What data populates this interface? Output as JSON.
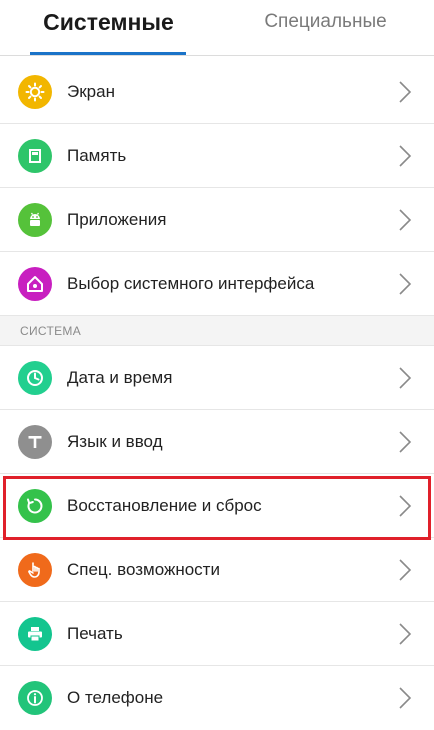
{
  "tabs": {
    "system_label": "Системные",
    "special_label": "Специальные",
    "active": "system"
  },
  "section_system_header": "СИСТЕМА",
  "items": [
    {
      "label": "Экран",
      "icon": "screen-brightness-icon",
      "color": "#f2b600"
    },
    {
      "label": "Память",
      "icon": "memory-card-icon",
      "color": "#2ec56a"
    },
    {
      "label": "Приложения",
      "icon": "android-app-icon",
      "color": "#55c23a"
    },
    {
      "label": "Выбор системного интерфейса",
      "icon": "home-interface-icon",
      "color": "#c81fc0"
    },
    {
      "label": "Дата и время",
      "icon": "clock-icon",
      "color": "#22cf8f"
    },
    {
      "label": "Язык и ввод",
      "icon": "language-t-icon",
      "color": "#8f8f8f"
    },
    {
      "label": "Восстановление и сброс",
      "icon": "restore-reset-icon",
      "color": "#34c24b"
    },
    {
      "label": "Спец. возможности",
      "icon": "accessibility-hand-icon",
      "color": "#f06a1b"
    },
    {
      "label": "Печать",
      "icon": "printer-icon",
      "color": "#13c58f"
    },
    {
      "label": "О телефоне",
      "icon": "info-icon",
      "color": "#22c47a"
    }
  ]
}
